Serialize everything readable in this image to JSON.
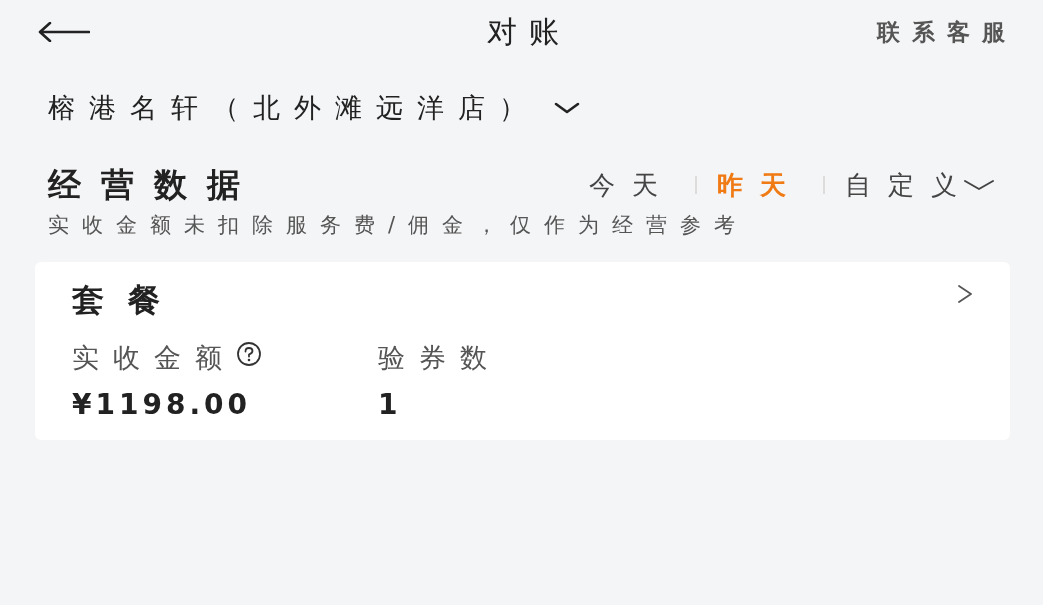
{
  "header": {
    "title": "对账",
    "action": "联系客服"
  },
  "store": {
    "name": "榕港名轩（北外滩远洋店）"
  },
  "section": {
    "title": "经营数据",
    "date_tabs": [
      {
        "label": "今天",
        "selected": false,
        "kind": "plain"
      },
      {
        "label": "昨天",
        "selected": true,
        "kind": "plain"
      },
      {
        "label": "自定义",
        "selected": false,
        "kind": "dropdown"
      }
    ],
    "note": "实收金额未扣除服务费/佣金，仅作为经营参考"
  },
  "card": {
    "title": "套餐",
    "metrics": [
      {
        "label": "实收金额",
        "value": "¥1198.00",
        "help": true
      },
      {
        "label": "验券数",
        "value": "1",
        "help": false
      }
    ]
  }
}
